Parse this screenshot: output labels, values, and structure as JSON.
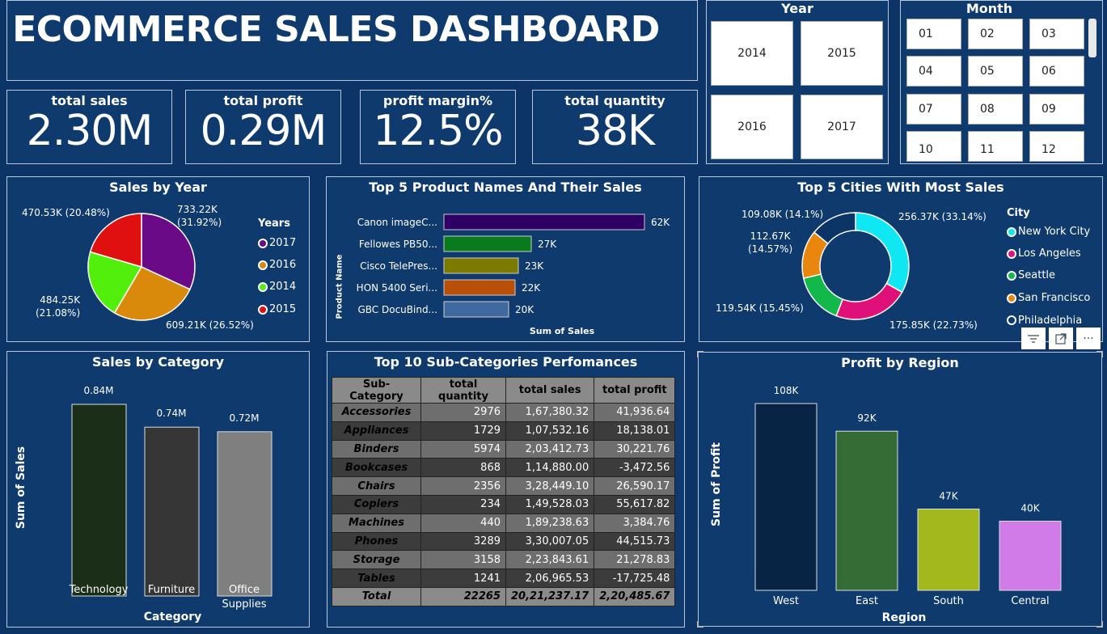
{
  "title": "ECOMMERCE SALES DASHBOARD",
  "kpis": {
    "total_sales": {
      "label": "total sales",
      "value": "2.30M"
    },
    "total_profit": {
      "label": "total profit",
      "value": "0.29M"
    },
    "profit_margin": {
      "label": "profit margin%",
      "value": "12.5%"
    },
    "total_quantity": {
      "label": "total quantity",
      "value": "38K"
    }
  },
  "year_slicer": {
    "title": "Year",
    "options": [
      "2014",
      "2015",
      "2016",
      "2017"
    ]
  },
  "month_slicer": {
    "title": "Month",
    "options": [
      "01",
      "02",
      "03",
      "04",
      "05",
      "06",
      "07",
      "08",
      "09",
      "10",
      "11",
      "12"
    ]
  },
  "sales_by_year": {
    "title": "Sales by Year",
    "legend_title": "Years",
    "legend": [
      "2017",
      "2016",
      "2014",
      "2015"
    ],
    "labels": {
      "y2017": "733.22K\n(31.92%)",
      "y2016": "609.21K (26.52%)",
      "y2014": "484.25K\n(21.08%)",
      "y2015": "470.53K (20.48%)"
    }
  },
  "top_products": {
    "title": "Top 5 Product Names And Their Sales",
    "xlabel": "Sum of Sales",
    "ylabel": "Product Name",
    "names": [
      "Canon imageC...",
      "Fellowes PB50...",
      "Cisco TelePres...",
      "HON 5400 Seri...",
      "GBC DocuBind..."
    ],
    "value_labels": [
      "62K",
      "27K",
      "23K",
      "22K",
      "20K"
    ]
  },
  "top_cities": {
    "title": "Top 5 Cities With Most Sales",
    "legend_title": "City",
    "legend": [
      "New York City",
      "Los Angeles",
      "Seattle",
      "San Francisco",
      "Philadelphia"
    ],
    "labels": [
      "256.37K (33.14%)",
      "175.85K (22.73%)",
      "119.54K (15.45%)",
      "112.67K\n(14.57%)",
      "109.08K (14.1%)"
    ]
  },
  "sales_by_category": {
    "title": "Sales by Category",
    "xlabel": "Category",
    "ylabel": "Sum of Sales",
    "categories": [
      "Technology",
      "Furniture",
      "Office\nSupplies"
    ],
    "value_labels": [
      "0.84M",
      "0.74M",
      "0.72M"
    ]
  },
  "subcategories": {
    "title": "Top 10 Sub-Categories Perfomances",
    "headers": [
      "Sub-Category",
      "total quantity",
      "total sales",
      "total profit"
    ],
    "rows": [
      [
        "Accessories",
        "2976",
        "1,67,380.32",
        "41,936.64"
      ],
      [
        "Appliances",
        "1729",
        "1,07,532.16",
        "18,138.01"
      ],
      [
        "Binders",
        "5974",
        "2,03,412.73",
        "30,221.76"
      ],
      [
        "Bookcases",
        "868",
        "1,14,880.00",
        "-3,472.56"
      ],
      [
        "Chairs",
        "2356",
        "3,28,449.10",
        "26,590.17"
      ],
      [
        "Copiers",
        "234",
        "1,49,528.03",
        "55,617.82"
      ],
      [
        "Machines",
        "440",
        "1,89,238.63",
        "3,384.76"
      ],
      [
        "Phones",
        "3289",
        "3,30,007.05",
        "44,515.73"
      ],
      [
        "Storage",
        "3158",
        "2,23,843.61",
        "21,278.83"
      ],
      [
        "Tables",
        "1241",
        "2,06,965.53",
        "-17,725.48"
      ]
    ],
    "total": [
      "Total",
      "22265",
      "20,21,237.17",
      "2,20,485.67"
    ]
  },
  "profit_by_region": {
    "title": "Profit by Region",
    "xlabel": "Region",
    "ylabel": "Sum of Profit",
    "regions": [
      "West",
      "East",
      "South",
      "Central"
    ],
    "value_labels": [
      "108K",
      "92K",
      "47K",
      "40K"
    ]
  },
  "chart_data": [
    {
      "type": "pie",
      "title": "Sales by Year",
      "categories": [
        "2017",
        "2016",
        "2014",
        "2015"
      ],
      "values": [
        733.22,
        609.21,
        484.25,
        470.53
      ],
      "percentages": [
        31.92,
        26.52,
        21.08,
        20.48
      ],
      "colors": [
        "#6b0a87",
        "#d98a0a",
        "#52ef0d",
        "#e01010"
      ],
      "legend_placement": "right"
    },
    {
      "type": "bar",
      "title": "Top 5 Product Names And Their Sales",
      "orientation": "horizontal",
      "categories": [
        "Canon imageC...",
        "Fellowes PB50...",
        "Cisco TelePres...",
        "HON 5400 Seri...",
        "GBC DocuBind..."
      ],
      "values": [
        62,
        27,
        23,
        22,
        20
      ],
      "unit": "K",
      "colors": [
        "#2e0066",
        "#0a7a1e",
        "#7d7a00",
        "#b8500a",
        "#3f6aa0"
      ],
      "xlabel": "Sum of Sales",
      "ylabel": "Product Name"
    },
    {
      "type": "pie",
      "subtype": "donut",
      "title": "Top 5 Cities With Most Sales",
      "categories": [
        "New York City",
        "Los Angeles",
        "Seattle",
        "San Francisco",
        "Philadelphia"
      ],
      "values": [
        256.37,
        175.85,
        119.54,
        112.67,
        109.08
      ],
      "percentages": [
        33.14,
        22.73,
        15.45,
        14.57,
        14.1
      ],
      "colors": [
        "#0fe8f2",
        "#e0107a",
        "#12b84a",
        "#e8860e",
        "#0e3a6e"
      ],
      "legend_placement": "right"
    },
    {
      "type": "bar",
      "title": "Sales by Category",
      "categories": [
        "Technology",
        "Furniture",
        "Office Supplies"
      ],
      "values": [
        0.84,
        0.74,
        0.72
      ],
      "unit": "M",
      "colors": [
        "#1b2e17",
        "#363636",
        "#7f7f7f"
      ],
      "xlabel": "Category",
      "ylabel": "Sum of Sales"
    },
    {
      "type": "bar",
      "title": "Profit by Region",
      "categories": [
        "West",
        "East",
        "South",
        "Central"
      ],
      "values": [
        108,
        92,
        47,
        40
      ],
      "unit": "K",
      "colors": [
        "#082444",
        "#356b35",
        "#a3b81c",
        "#d07be8"
      ],
      "xlabel": "Region",
      "ylabel": "Sum of Profit"
    }
  ],
  "visual_toolbar": {
    "filter_icon": "filter-icon",
    "focus_icon": "focus-mode-icon",
    "more_icon": "more-options-icon",
    "more_label": "···"
  }
}
